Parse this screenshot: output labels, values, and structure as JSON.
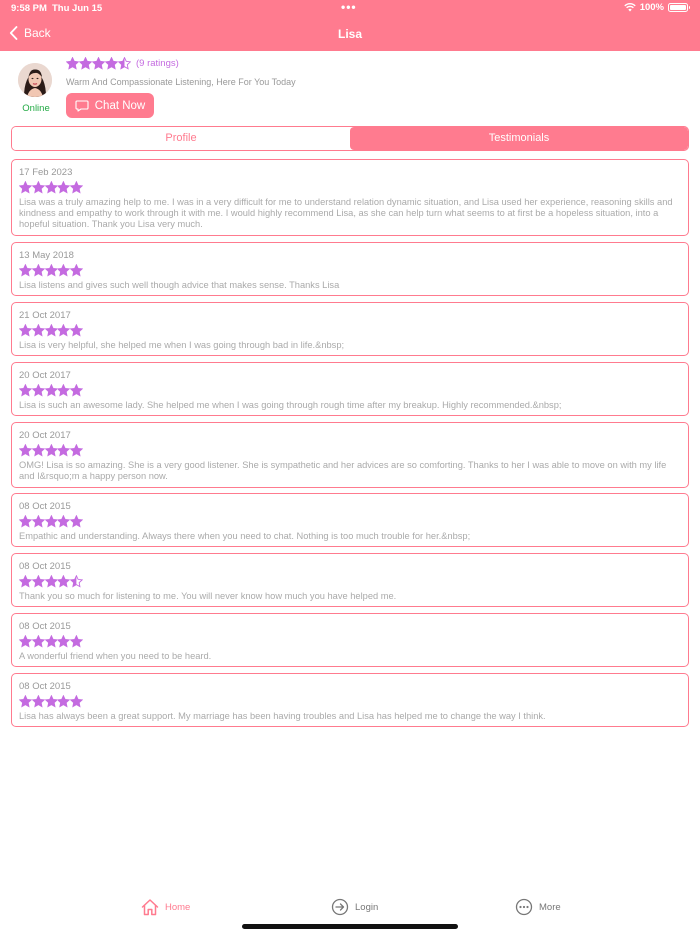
{
  "status_bar": {
    "time": "9:58 PM",
    "date": "Thu Jun 15",
    "dots": "•••",
    "battery": "100%"
  },
  "nav": {
    "back_label": "Back",
    "title": "Lisa"
  },
  "profile": {
    "rating": 4.5,
    "ratings_count": "(9 ratings)",
    "tagline": "Warm And Compassionate Listening, Here For You Today",
    "status": "Online",
    "chat_label": "Chat Now"
  },
  "tabs": {
    "profile": "Profile",
    "testimonials": "Testimonials",
    "selected": "Testimonials"
  },
  "testimonials": [
    {
      "date": "17 Feb 2023",
      "rating": 5,
      "text": "Lisa was a truly amazing help to me. I was in a very difficult for me to understand relation dynamic situation, and Lisa used her experience, reasoning skills and kindness and empathy to work through it with me. I would highly recommend Lisa, as she can help turn what seems to at first be a hopeless situation, into a hopeful situation.  Thank you Lisa very much."
    },
    {
      "date": "13 May 2018",
      "rating": 5,
      "text": "Lisa listens and gives such well though advice that makes sense. Thanks Lisa"
    },
    {
      "date": "21 Oct 2017",
      "rating": 5,
      "text": "Lisa is very helpful, she helped me when I was going through bad in life.&nbsp;"
    },
    {
      "date": "20 Oct 2017",
      "rating": 5,
      "text": "Lisa is such an awesome lady. She helped me when I was going through rough time after my breakup. Highly recommended.&nbsp;"
    },
    {
      "date": "20 Oct 2017",
      "rating": 5,
      "text": "OMG! Lisa is so amazing. She is a very good listener. She is sympathetic and her advices are so comforting. Thanks to her I was able to move on with my life and I&rsquo;m a happy person now."
    },
    {
      "date": "08 Oct 2015",
      "rating": 5,
      "text": "Empathic and understanding. Always there when you need to chat. Nothing is too much trouble for her.&nbsp;"
    },
    {
      "date": "08 Oct 2015",
      "rating": 4.5,
      "text": "Thank you so much for listening to me. You will never know how much you have helped me."
    },
    {
      "date": "08 Oct 2015",
      "rating": 5,
      "text": "A wonderful friend when you need to be heard."
    },
    {
      "date": "08 Oct 2015",
      "rating": 5,
      "text": "Lisa has always been a great support. My marriage has been having troubles and Lisa has helped me to change the way I think."
    }
  ],
  "tabbar": {
    "home": "Home",
    "login": "Login",
    "more": "More"
  },
  "colors": {
    "accent": "#ff7b8f",
    "star": "#c46be0",
    "online": "#22aa44"
  },
  "icons": {
    "back": "chevron-left-icon",
    "chat": "speech-bubble-icon",
    "home": "house-icon",
    "login": "arrow-right-circle-icon",
    "more": "ellipsis-circle-icon"
  }
}
